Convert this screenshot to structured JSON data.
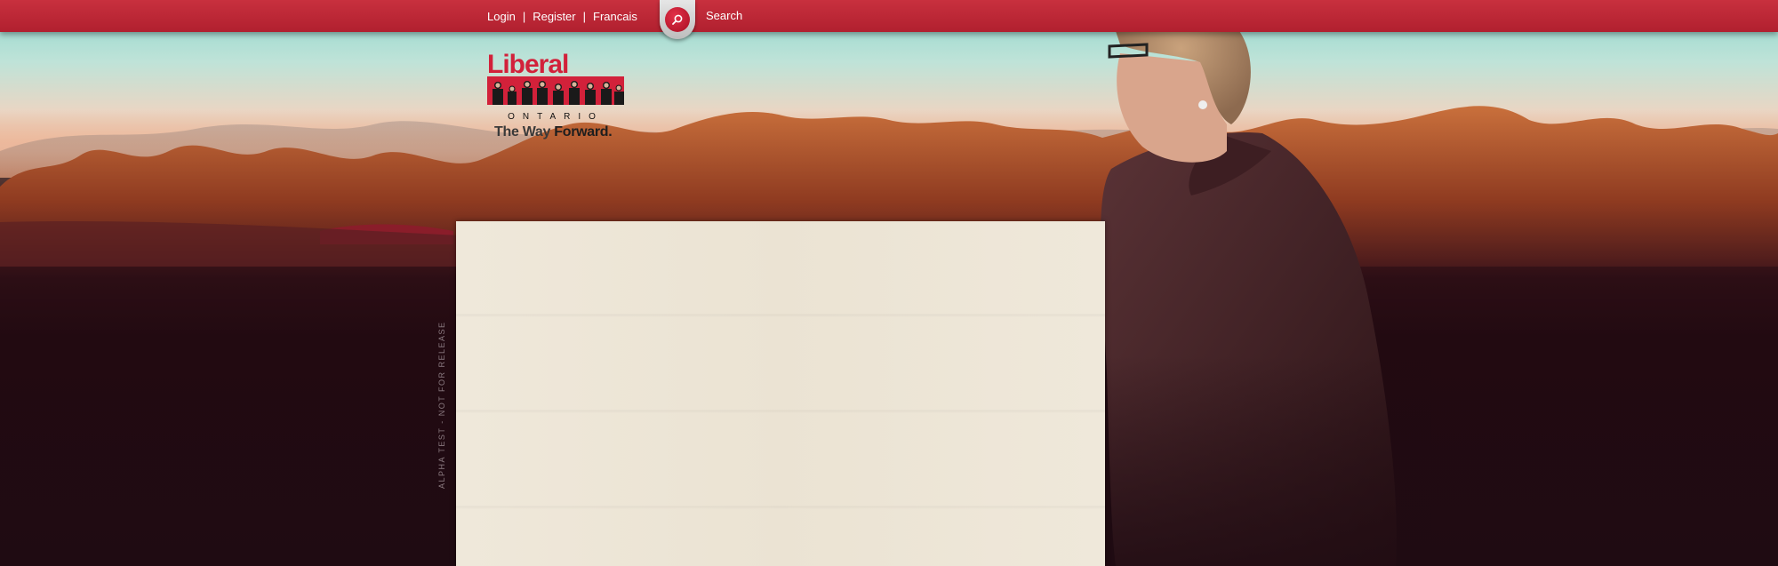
{
  "topbar": {
    "login_label": "Login",
    "separator": "|",
    "register_label": "Register",
    "language_label": "Francais",
    "search_label": "Search",
    "search_icon": "magnifier-icon"
  },
  "logo": {
    "wordmark": "Liberal",
    "province": "ONTARIO",
    "tagline_prefix": "The Way ",
    "tagline_emph": "Forward."
  },
  "watermark": "ALPHA TEST - NOT FOR RELEASE",
  "colors": {
    "brand_red": "#c8303e",
    "logo_red": "#d2213a",
    "paper": "#ede6d7",
    "dark_bg": "#1f0b12"
  }
}
